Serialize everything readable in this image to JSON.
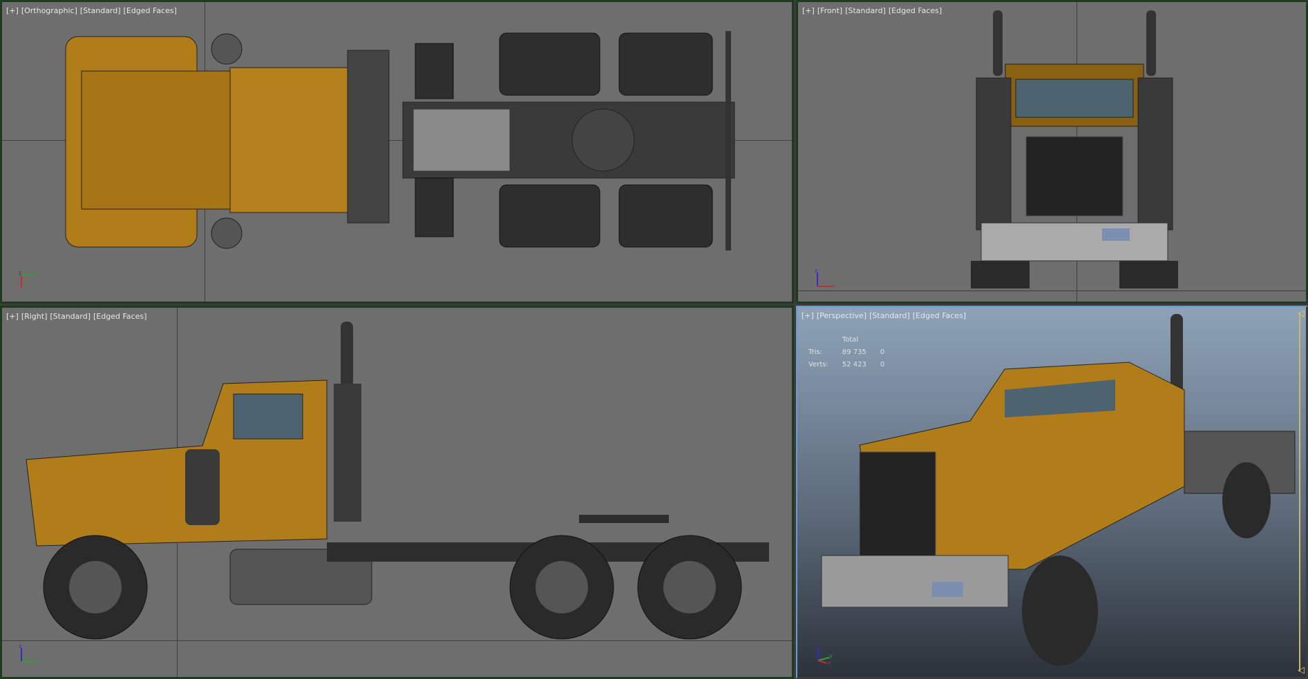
{
  "viewports": [
    {
      "labels": [
        "[+]",
        "[Orthographic]",
        "[Standard]",
        "[Edged Faces]"
      ],
      "axis": [
        "z",
        "y"
      ]
    },
    {
      "labels": [
        "[+]",
        "[Front]",
        "[Standard]",
        "[Edged Faces]"
      ],
      "axis": [
        "z",
        "x"
      ]
    },
    {
      "labels": [
        "[+]",
        "[Right]",
        "[Standard]",
        "[Edged Faces]"
      ],
      "axis": [
        "z",
        "y"
      ]
    },
    {
      "labels": [
        "[+]",
        "[Perspective]",
        "[Standard]",
        "[Edged Faces]"
      ],
      "axis": [
        "z",
        "y",
        "x"
      ]
    }
  ],
  "stats": {
    "header": "Total",
    "rows": [
      {
        "label": "Tris:",
        "total": "89 735",
        "selected": "0"
      },
      {
        "label": "Verts:",
        "total": "52 423",
        "selected": "0"
      }
    ]
  },
  "colors": {
    "body": "#b07d1a",
    "chassis": "#2e2e2e",
    "viewport": "#6e6e6e",
    "border": "#1f3a1f",
    "active_border": "#6c9cd6"
  }
}
